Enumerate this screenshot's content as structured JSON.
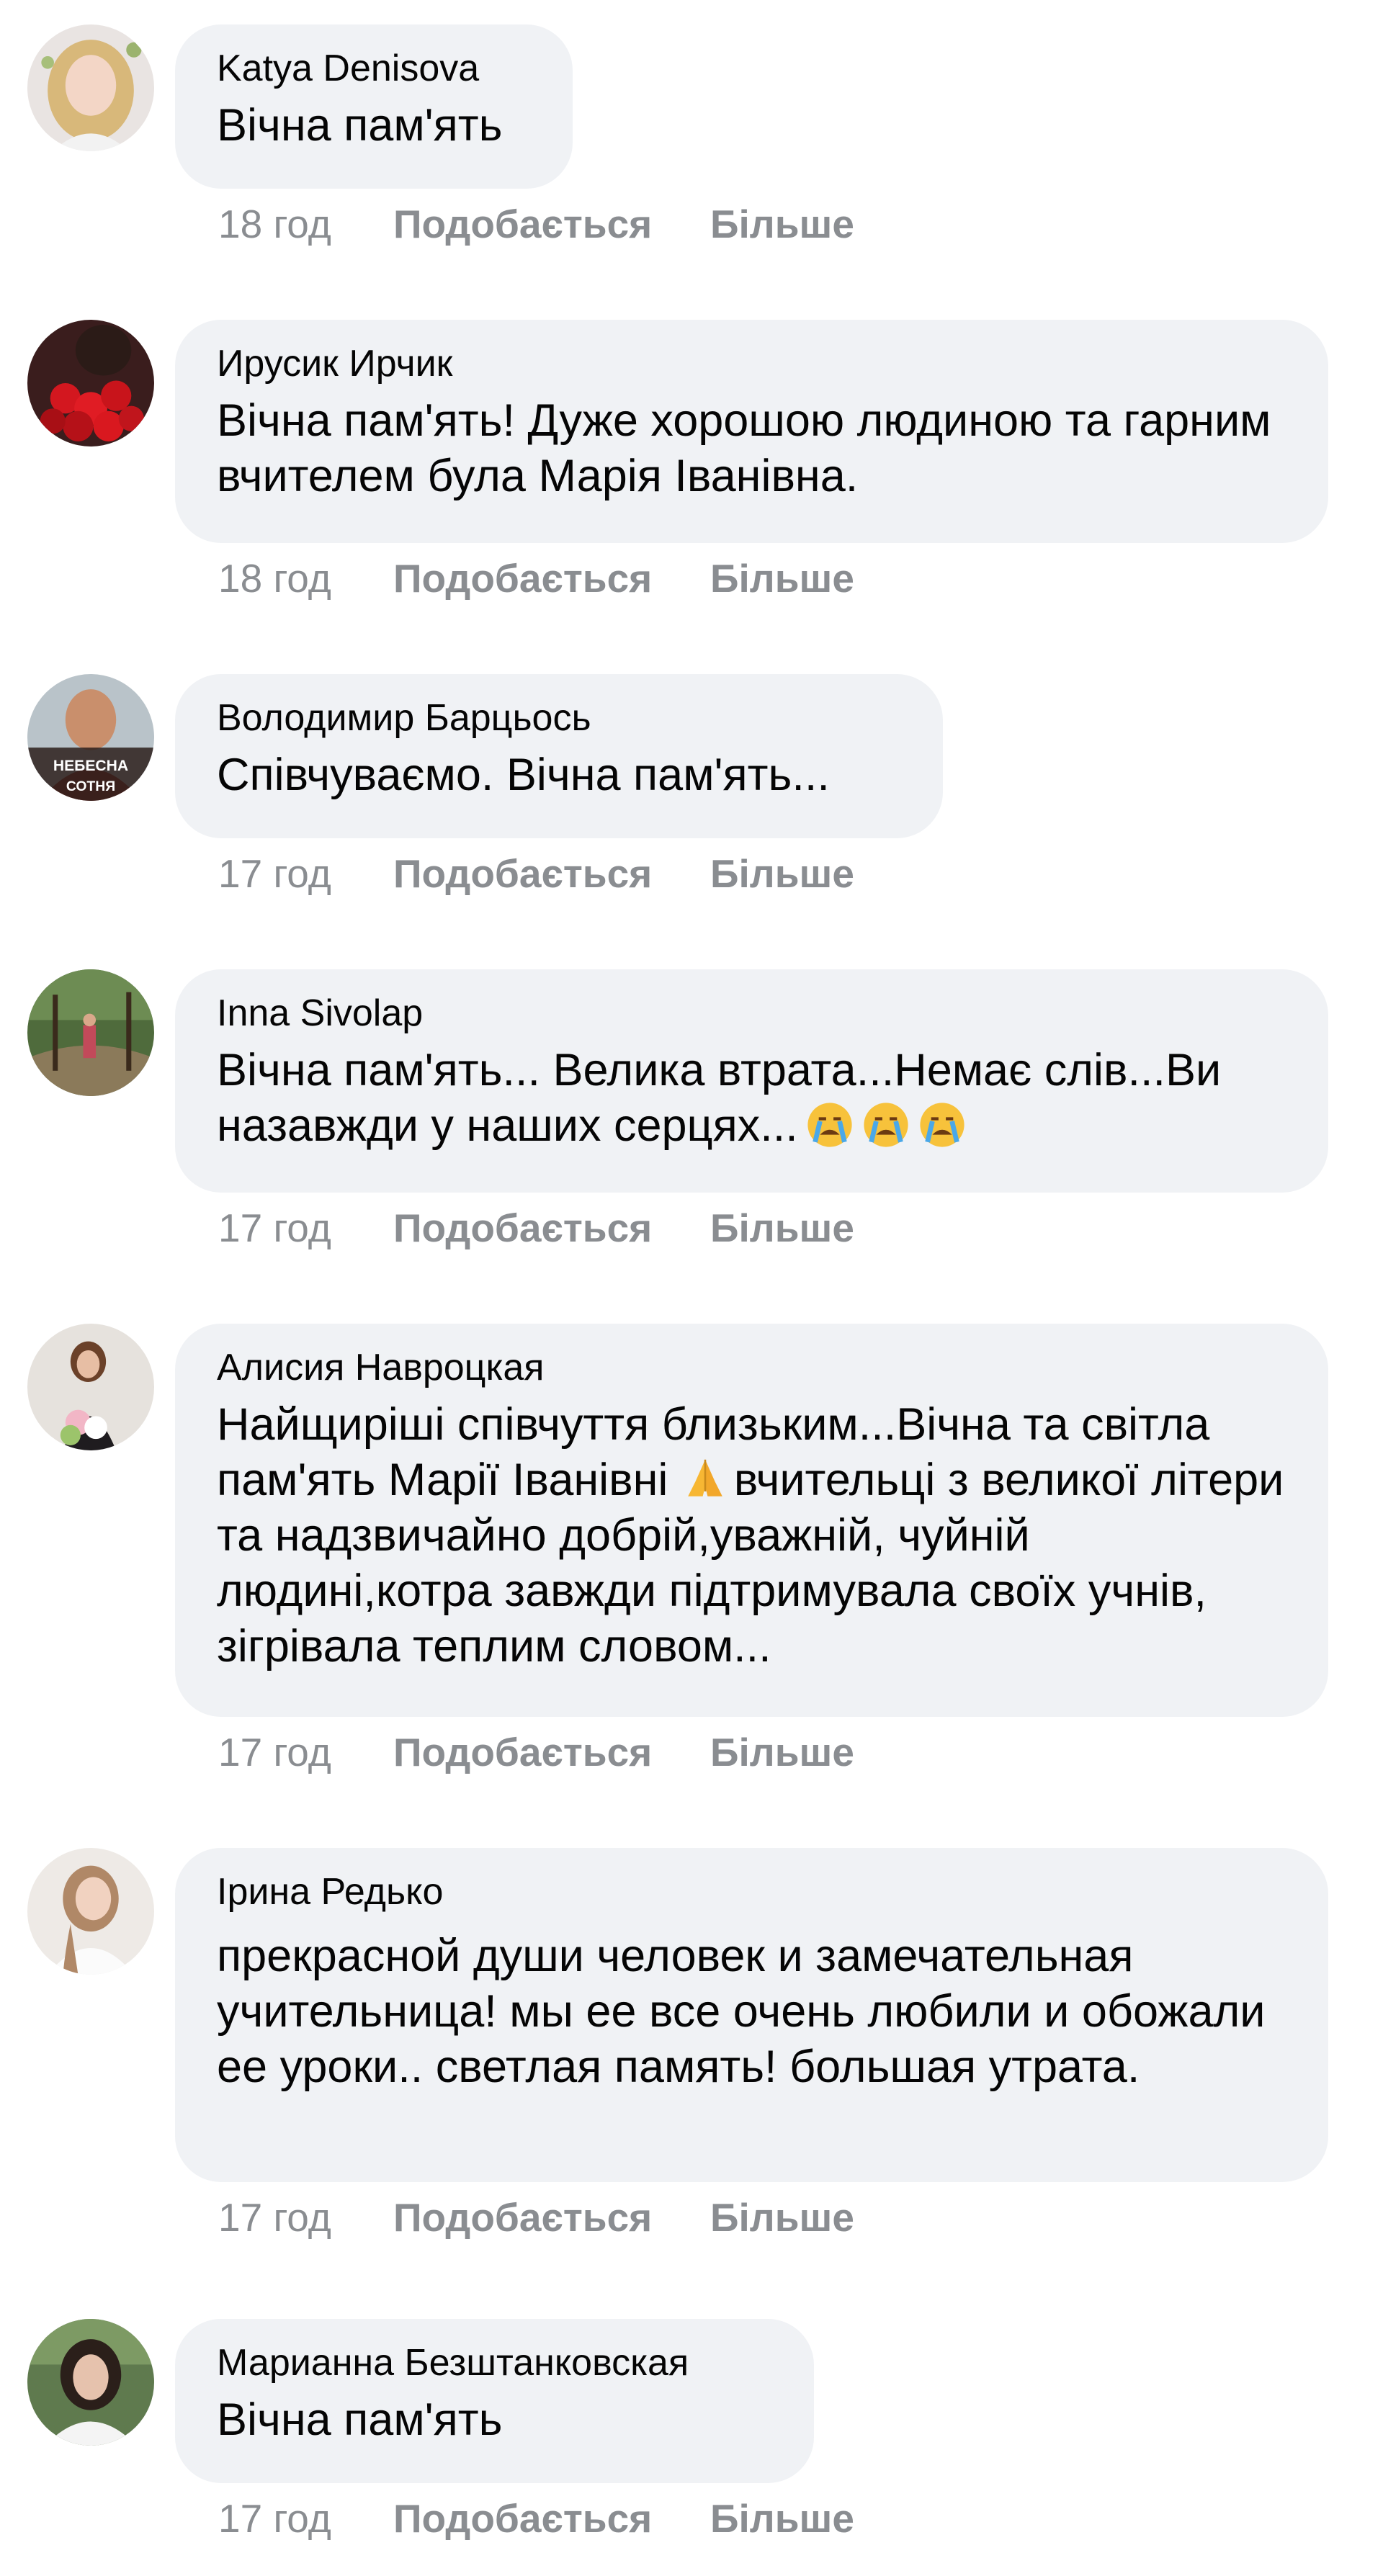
{
  "comments": [
    {
      "author": "Katya Denisova",
      "text": "Вічна пам'ять",
      "emoji": "",
      "time": "18 год",
      "like_label": "Подобається",
      "more_label": "Більше",
      "avatar": "avatar-katya"
    },
    {
      "author": "Ирусик Ирчик",
      "text": "Вічна пам'ять! Дуже хорошою людиною та гарним вчителем була Марія Іванівна.",
      "emoji": "",
      "time": "18 год",
      "like_label": "Подобається",
      "more_label": "Більше",
      "avatar": "avatar-roses"
    },
    {
      "author": "Володимир Барцьось",
      "text": "Співчуваємо. Вічна пам'ять...",
      "emoji": "",
      "time": "17 год",
      "like_label": "Подобається",
      "more_label": "Більше",
      "avatar": "avatar-volodymyr",
      "avatar_badge_lines": [
        "НЕБЕСНА",
        "СОТНЯ"
      ]
    },
    {
      "author": "Inna Sivolap",
      "text": "Вічна пам'ять... Велика втрата...Немає слів...Ви назавжди у наших серцях...",
      "emoji": "crying-face-emoji ×3",
      "time": "17 год",
      "like_label": "Подобається",
      "more_label": "Більше",
      "avatar": "avatar-inna"
    },
    {
      "author": "Алисия Навроцкая",
      "text_before": "Найщиріші співчуття близьким...Вічна та світла пам'ять Марії Іванівні ",
      "text_after": "вчительці з великої літери та надзвичайно добрій,уважній, чуйній людині,котра завжди підтримувала своїх учнів, зігрівала теплим словом...",
      "emoji": "folded-hands-emoji",
      "time": "17 год",
      "like_label": "Подобається",
      "more_label": "Більше",
      "avatar": "avatar-alisia"
    },
    {
      "author": "Ірина Редько",
      "text": "прекрасной души человек и замечательная учительница! мы ее все очень любили и обожали ее уроки.. светлая память! большая утрата.",
      "emoji": "",
      "time": "17 год",
      "like_label": "Подобається",
      "more_label": "Більше",
      "avatar": "avatar-iryna"
    },
    {
      "author": "Марианна Безштанковская",
      "text": "Вічна пам'ять",
      "emoji": "",
      "time": "17 год",
      "like_label": "Подобається",
      "more_label": "Більше",
      "avatar": "avatar-marianna"
    }
  ],
  "colors": {
    "bubble": "#f0f2f5",
    "text": "#050505",
    "meta": "#8a8d91"
  }
}
